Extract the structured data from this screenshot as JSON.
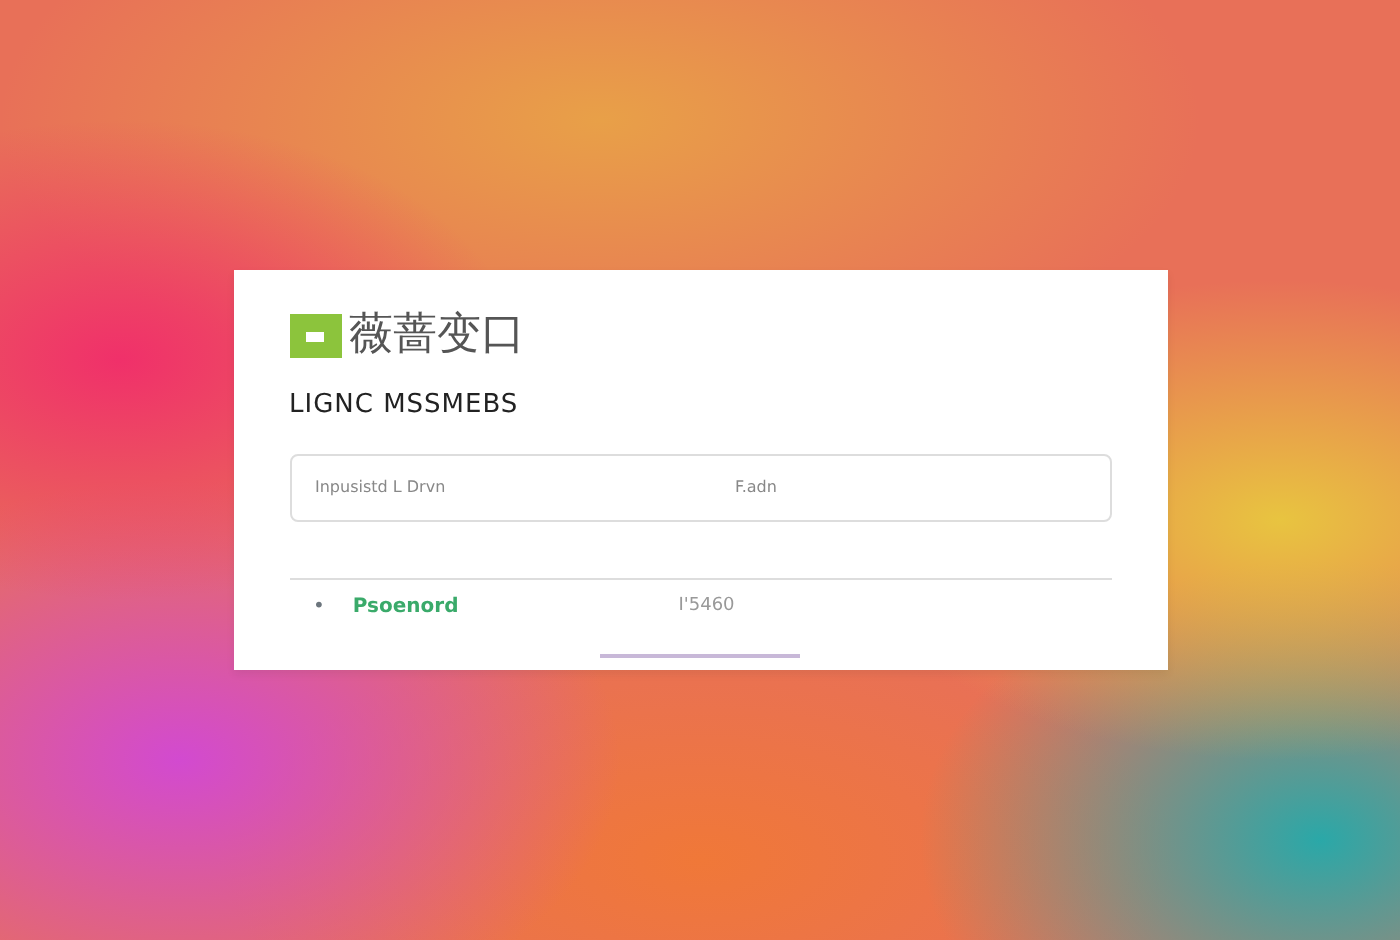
{
  "brand": {
    "title": "薇蔷变口"
  },
  "heading": "LIGNC MSSMEBS",
  "field": {
    "label": "Inpusistd L Drvn",
    "value": "F.adn"
  },
  "password_row": {
    "bullet": "•",
    "label": "Psoenord",
    "value": "I'5460"
  }
}
